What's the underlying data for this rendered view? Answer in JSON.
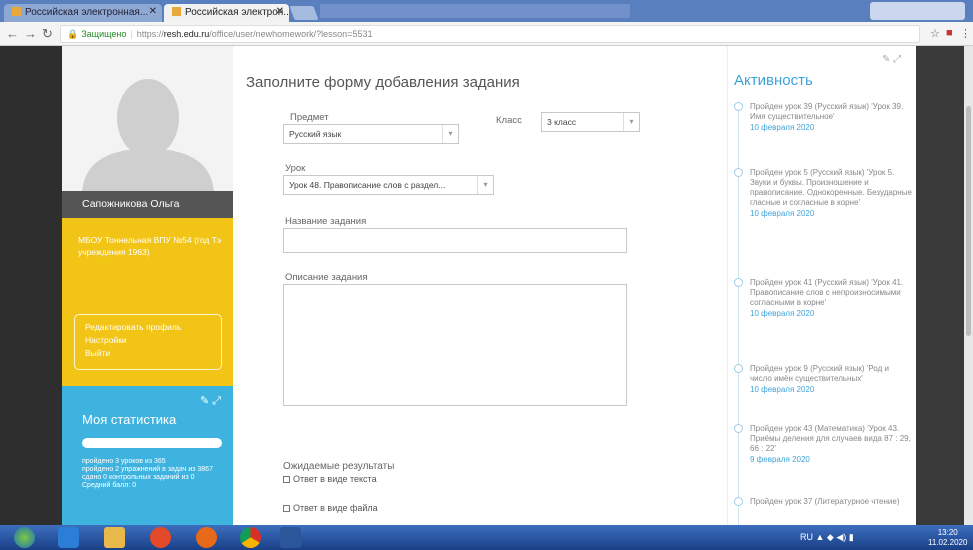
{
  "browser": {
    "tabs": [
      {
        "label": "Российская электронная..."
      },
      {
        "label": "Российская электрон..."
      }
    ],
    "address": {
      "secure_label": "Защищено",
      "url_prefix": "https://",
      "url_domain": "resh.edu.ru",
      "url_path": "/office/user/newhomework/?lesson=5531"
    }
  },
  "profile": {
    "name": "Сапожникова Ольга",
    "school": "МБОУ Тоннельная ВПУ №54 (год Тэ учреждения 1963)",
    "menu": [
      "Редактировать профиль",
      "Настройки",
      "Выйти"
    ]
  },
  "stats": {
    "title": "Моя статистика",
    "lines": [
      "пройдено 3 уроков из 365",
      "пройдено 2 упражнений в задач из 3867",
      "сдано 0 контрольных заданий из 0",
      "Средний балл: 0"
    ]
  },
  "form": {
    "title": "Заполните форму добавления задания",
    "subject_label": "Предмет",
    "subject_value": "Русский язык",
    "class_label": "Класс",
    "class_value": "3 класс",
    "lesson_label": "Урок",
    "lesson_value": "Урок 48. Правописание слов с раздел...",
    "name_label": "Название задания",
    "desc_label": "Описание задания",
    "results_label": "Ожидаемые результаты",
    "answer_text": "Ответ в виде текста",
    "answer_file": "Ответ в виде файла"
  },
  "activity": {
    "title": "Активность",
    "items": [
      {
        "text": "Пройден урок 39 (Русский язык) 'Урок 39. Имя существительное'",
        "date": "10 февраля 2020"
      },
      {
        "text": "Пройден урок 5 (Русский язык) 'Урок 5. Звуки и буквы. Произношение и правописание. Однокоренные. Безударные гласные и согласные в корне'",
        "date": "10 февраля 2020"
      },
      {
        "text": "Пройден урок 41 (Русский язык) 'Урок 41. Правописание слов с непроизносимыми согласными в корне'",
        "date": "10 февраля 2020"
      },
      {
        "text": "Пройден урок 9 (Русский язык) 'Род и число имён существительных'",
        "date": "10 февраля 2020"
      },
      {
        "text": "Пройден урок 43 (Математика) 'Урок 43. Приёмы деления для случаев вида 87 : 29, 66 : 22'",
        "date": "9 февраля 2020"
      },
      {
        "text": "Пройден урок 37 (Литературное чтение)",
        "date": ""
      }
    ]
  },
  "taskbar": {
    "lang": "RU",
    "time": "13:20",
    "date": "11.02.2020"
  }
}
